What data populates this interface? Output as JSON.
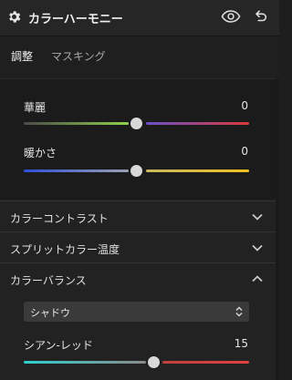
{
  "header": {
    "title": "カラーハーモニー",
    "icons": [
      "gear-icon",
      "eye-icon",
      "undo-icon"
    ]
  },
  "tabs": [
    {
      "label": "調整",
      "active": true
    },
    {
      "label": "マスキング",
      "active": false
    }
  ],
  "sliders": [
    {
      "label": "華麗",
      "value": "0",
      "colors": [
        "#4a4a4a",
        "#8fd14a",
        "#6a4fc8",
        "#d83a3a"
      ]
    },
    {
      "label": "暖かさ",
      "value": "0",
      "colors": [
        "#2f4fd8",
        "#9aa0b0",
        "#c8b860",
        "#f0c020"
      ]
    }
  ],
  "sections": [
    {
      "label": "カラーコントラスト",
      "expanded": false
    },
    {
      "label": "スプリットカラー温度",
      "expanded": false
    },
    {
      "label": "カラーバランス",
      "expanded": true
    }
  ],
  "balance": {
    "dropdown_value": "シャドウ",
    "slider": {
      "label": "シアン-レッド",
      "value": "15",
      "colors": [
        "#2fd0d0",
        "#8a8a8a",
        "#c04040",
        "#e04040"
      ]
    }
  }
}
